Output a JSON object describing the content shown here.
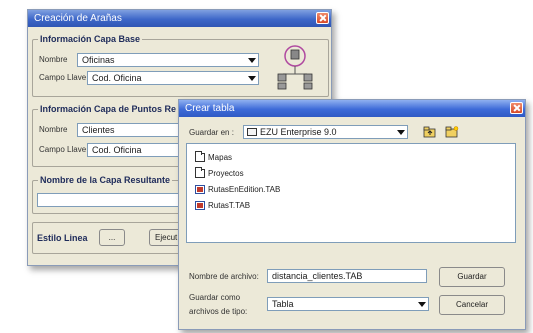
{
  "arana_window": {
    "title": "Creación de Arañas",
    "base_group": {
      "legend": "Información Capa Base",
      "nombre_label": "Nombre",
      "nombre_value": "Oficinas",
      "campo_label": "Campo Llave",
      "campo_value": "Cod. Oficina"
    },
    "puntos_group": {
      "legend": "Información Capa de Puntos Re",
      "nombre_label": "Nombre",
      "nombre_value": "Clientes",
      "campo_label": "Campo Llave",
      "campo_value": "Cod. Oficina"
    },
    "resultante_group": {
      "legend": "Nombre de la Capa Resultante"
    },
    "estilo_label": "Estilo Linea",
    "estilo_button": "...",
    "ejecutar_label": "Ejecut"
  },
  "crear_window": {
    "title": "Crear tabla",
    "guardar_en_label": "Guardar en :",
    "guardar_en_value": "EZU Enterprise 9.0",
    "files": [
      {
        "name": "Mapas",
        "icon": "folder-icon"
      },
      {
        "name": "Proyectos",
        "icon": "folder-icon"
      },
      {
        "name": "RutasEnEdition.TAB",
        "icon": "tab-file-icon"
      },
      {
        "name": "RutasT.TAB",
        "icon": "tab-file-icon"
      }
    ],
    "nombre_archivo_label": "Nombre de archivo:",
    "nombre_archivo_value": "distancia_clientes.TAB",
    "guardar_button": "Guardar",
    "tipo_label_line1": "Guardar como",
    "tipo_label_line2": "archivos de tipo:",
    "tipo_value": "Tabla",
    "cancelar_button": "Cancelar"
  },
  "colors": {
    "title_bar": "#3d66c8",
    "window_bg": "#ece9d8",
    "legend_text": "#1e2b5a",
    "close_button": "#d84a28",
    "network_icon": "#b04aa0"
  }
}
